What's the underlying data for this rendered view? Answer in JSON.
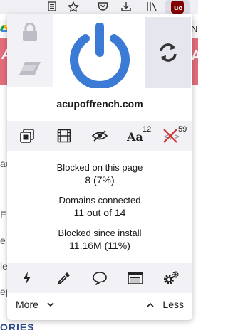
{
  "browser": {
    "toolbar_icons": [
      "reader-view-icon",
      "bookmark-star-icon",
      "pocket-icon",
      "downloads-icon",
      "library-icon",
      "ublock-origin-icon"
    ]
  },
  "background_page": {
    "bookmark_letter": "N",
    "banner_left": "A",
    "banner_right": "A",
    "side_letters": [
      "ac",
      "E v",
      "e",
      "le",
      "ep"
    ],
    "bottom_text": "ORIES"
  },
  "popup": {
    "hostname": "acupoffrench.com",
    "power_color": "#3b7bd6",
    "tools": [
      {
        "name": "element-zapper-icon",
        "count": ""
      },
      {
        "name": "media-elements-icon",
        "count": ""
      },
      {
        "name": "cosmetic-filter-icon",
        "count": ""
      },
      {
        "name": "remote-fonts-icon",
        "count": "12"
      },
      {
        "name": "javascript-blocked-icon",
        "count": "59"
      }
    ],
    "stats": {
      "blocked_page_label": "Blocked on this page",
      "blocked_page_value": "8 (7%)",
      "domains_label": "Domains connected",
      "domains_value": "11 out of 14",
      "blocked_install_label": "Blocked since install",
      "blocked_install_value": "11.16M (11%)"
    },
    "actions": [
      "lightning-icon",
      "eyedropper-icon",
      "speech-bubble-icon",
      "logger-icon",
      "settings-icon"
    ],
    "more_label": "More",
    "less_label": "Less"
  }
}
